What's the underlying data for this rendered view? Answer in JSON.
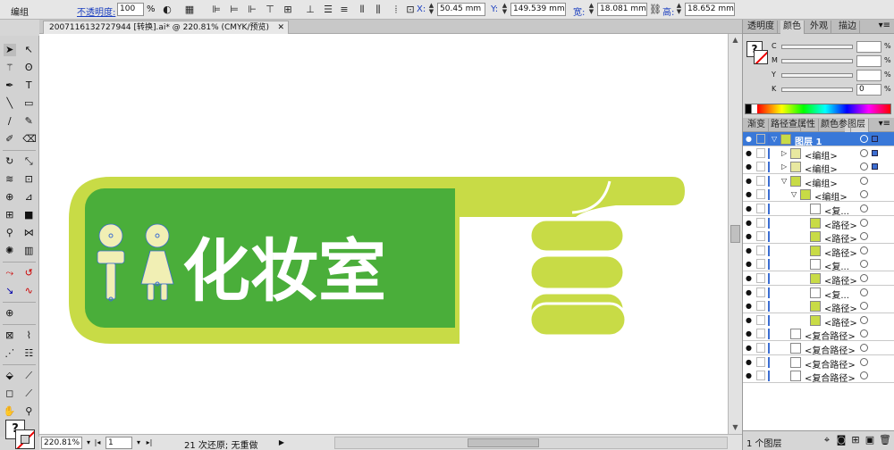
{
  "control": {
    "group_label": "编组",
    "opacity_label": "不透明度:",
    "opacity_value": "100",
    "opacity_unit": "%",
    "x_label": "X:",
    "x_value": "50.45 mm",
    "y_label": "Y:",
    "y_value": "149.539 mm",
    "w_label": "宽:",
    "w_value": "18.081 mm",
    "h_label": "高:",
    "h_value": "18.652 mm"
  },
  "document": {
    "tab_title": "2007116132727944 [转换].ai* @ 220.81% (CMYK/预览)",
    "close": "✕"
  },
  "artwork": {
    "text": "化妆室",
    "green_light": "#c8db46",
    "green_dark": "#4aae3a",
    "figure_fill": "#f1efb4"
  },
  "status": {
    "zoom": "220.81%",
    "page": "1",
    "message": "21 次还原; 无重做"
  },
  "color_panel": {
    "tabs": [
      "透明度",
      "颜色",
      "外观",
      "描边"
    ],
    "active_tab": 1,
    "menu": "▾≡",
    "rows": [
      {
        "label": "C",
        "value": "",
        "unit": "%"
      },
      {
        "label": "M",
        "value": "",
        "unit": "%"
      },
      {
        "label": "Y",
        "value": "",
        "unit": "%"
      },
      {
        "label": "K",
        "value": "0",
        "unit": "%"
      }
    ]
  },
  "layers_panel": {
    "tabs": [
      "渐变",
      "路径查",
      "属性",
      "颜色参",
      "图层"
    ],
    "active_tab": 4,
    "menu": "▾≡",
    "rows": [
      {
        "name": "图层 1",
        "indent": 0,
        "arrow": "▽",
        "thumb": "#c8db46",
        "selected": true
      },
      {
        "name": "<编组>",
        "indent": 1,
        "arrow": "▷",
        "thumb": "#e8e8a0",
        "selected": true
      },
      {
        "name": "<编组>",
        "indent": 1,
        "arrow": "▷",
        "thumb": "#e8e8a0",
        "selected": true
      },
      {
        "name": "<编组>",
        "indent": 1,
        "arrow": "▽",
        "thumb": "#c8db46",
        "selected": false
      },
      {
        "name": "<编组>",
        "indent": 2,
        "arrow": "▽",
        "thumb": "#c8db46",
        "selected": false
      },
      {
        "name": "<复...",
        "indent": 3,
        "arrow": "",
        "thumb": "#ffffff",
        "selected": false
      },
      {
        "name": "<路径>",
        "indent": 3,
        "arrow": "",
        "thumb": "#c8db46",
        "selected": false
      },
      {
        "name": "<路径>",
        "indent": 3,
        "arrow": "",
        "thumb": "#c8db46",
        "selected": false
      },
      {
        "name": "<路径>",
        "indent": 3,
        "arrow": "",
        "thumb": "#c8db46",
        "selected": false
      },
      {
        "name": "<复...",
        "indent": 3,
        "arrow": "",
        "thumb": "#ffffff",
        "selected": false
      },
      {
        "name": "<路径>",
        "indent": 3,
        "arrow": "",
        "thumb": "#c8db46",
        "selected": false
      },
      {
        "name": "<复...",
        "indent": 3,
        "arrow": "",
        "thumb": "#ffffff",
        "selected": false
      },
      {
        "name": "<路径>",
        "indent": 3,
        "arrow": "",
        "thumb": "#c8db46",
        "selected": false
      },
      {
        "name": "<路径>",
        "indent": 3,
        "arrow": "",
        "thumb": "#c8db46",
        "selected": false
      },
      {
        "name": "<复合路径>",
        "indent": 1,
        "arrow": "",
        "thumb": "#ffffff",
        "selected": false
      },
      {
        "name": "<复合路径>",
        "indent": 1,
        "arrow": "",
        "thumb": "#ffffff",
        "selected": false
      },
      {
        "name": "<复合路径>",
        "indent": 1,
        "arrow": "",
        "thumb": "#ffffff",
        "selected": false
      },
      {
        "name": "<复合路径>",
        "indent": 1,
        "arrow": "",
        "thumb": "#ffffff",
        "selected": false
      }
    ],
    "footer_count": "1 个图层"
  }
}
